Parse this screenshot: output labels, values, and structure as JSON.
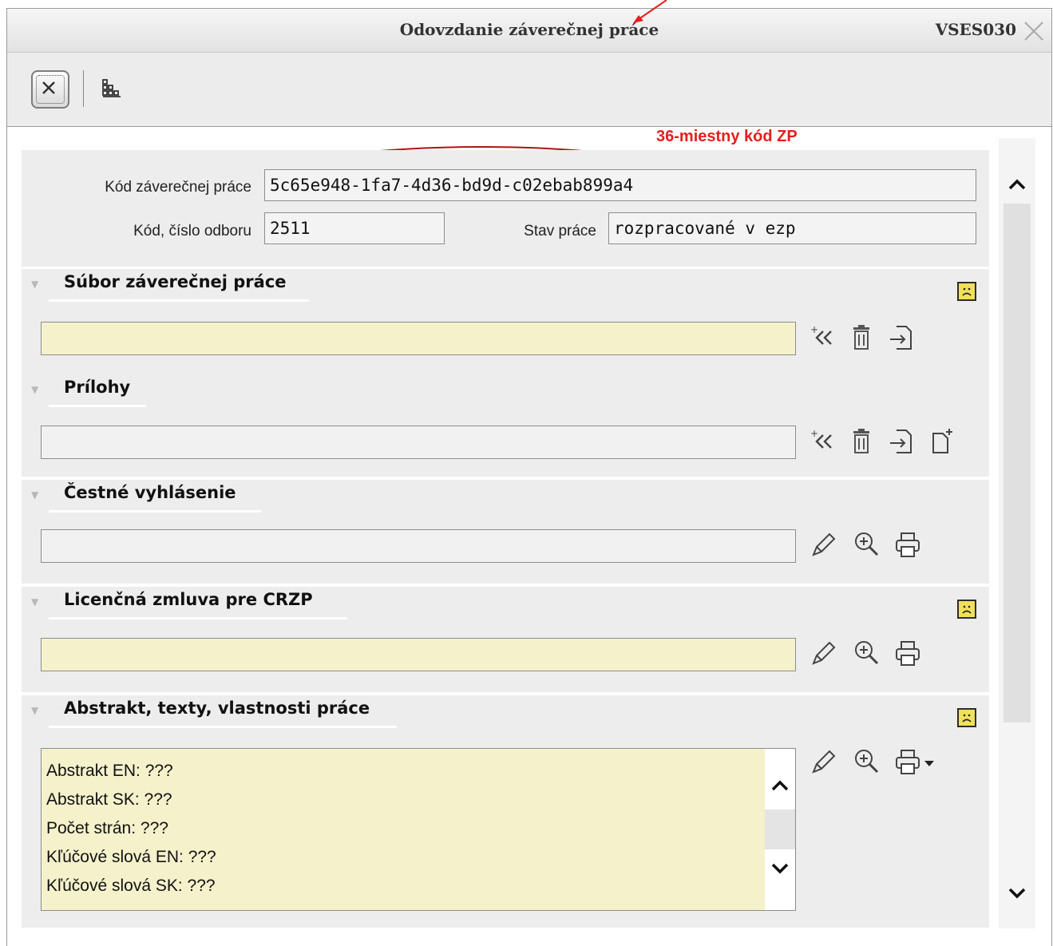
{
  "window": {
    "title": "Odovzdanie záverečnej práce",
    "app_code": "VSES030",
    "close_icon": "close-icon"
  },
  "toolbar": {
    "close_button_icon": "close-x-icon",
    "layout_icon": "grid-layout-icon"
  },
  "annotation": {
    "text": "36-miestny kód ZP",
    "color": "#e51e1e"
  },
  "header_fields": {
    "thesis_code_label": "Kód záverečnej práce",
    "thesis_code_value": "5c65e948-1fa7-4d36-bd9d-c02ebab899a4",
    "dept_label": "Kód, číslo odboru",
    "dept_value": "2511",
    "status_label": "Stav práce",
    "status_value": "rozpracované v ezp"
  },
  "sections": {
    "thesis_file": {
      "title": "Súbor záverečnej práce",
      "value": "",
      "status_icon": "sad-face-icon"
    },
    "attachments": {
      "title": "Prílohy",
      "value": ""
    },
    "declaration": {
      "title": "Čestné vyhlásenie",
      "value": ""
    },
    "license": {
      "title": "Licenčná zmluva pre CRZP",
      "value": "",
      "status_icon": "sad-face-icon"
    },
    "abstract": {
      "title": "Abstrakt, texty, vlastnosti práce",
      "status_icon": "sad-face-icon",
      "lines": [
        "Abstrakt EN: ???",
        "Abstrakt SK: ???",
        "Počet strán: ???",
        "Kľúčové slová EN: ???",
        "Kľúčové slová SK: ???"
      ]
    }
  },
  "colors": {
    "required_field": "#f5f1cb",
    "panel_bg": "#ededed"
  }
}
